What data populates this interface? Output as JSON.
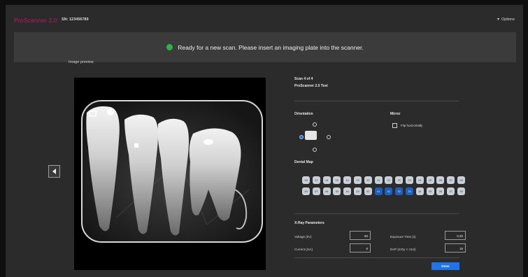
{
  "app": {
    "brand": "ProScanner 2.0",
    "serial": "SN: 123456789",
    "options_label": "Options"
  },
  "status": {
    "message": "Ready for a new scan. Please insert an imaging plate into the scanner.",
    "color": "#2fb24a"
  },
  "preview": {
    "label": "Image preview"
  },
  "scan": {
    "scan_of": "Scan 4 of 4",
    "device": "ProScanner 2.0 Test"
  },
  "orientation": {
    "label": "Orientation",
    "selected": "left"
  },
  "mirror": {
    "label": "Mirror",
    "flip_label": "Flip horizontally",
    "checked": false
  },
  "dental_map": {
    "label": "Dental Map",
    "upper": [
      "18",
      "17",
      "16",
      "15",
      "14",
      "13",
      "12",
      "11",
      "21",
      "22",
      "23",
      "24",
      "25",
      "26",
      "27",
      "28"
    ],
    "lower": [
      "48",
      "47",
      "46",
      "45",
      "44",
      "43",
      "42",
      "41",
      "31",
      "32",
      "33",
      "34",
      "35",
      "36",
      "37",
      "38"
    ],
    "selected": [
      "41",
      "31",
      "32",
      "33"
    ]
  },
  "xray": {
    "label": "X-Ray Parameters",
    "voltage_label": "Voltage (kV)",
    "voltage_value": "60",
    "exposure_label": "Exposure Time (s)",
    "exposure_value": "0,20",
    "current_label": "Current (mA)",
    "current_value": "8",
    "dap_label": "DAP (mGy × cm2)",
    "dap_value": "16"
  },
  "actions": {
    "done_label": "Done"
  },
  "colors": {
    "accent": "#2073e8",
    "brand": "#c01964",
    "tooth_selected": "#1f5fbf"
  }
}
